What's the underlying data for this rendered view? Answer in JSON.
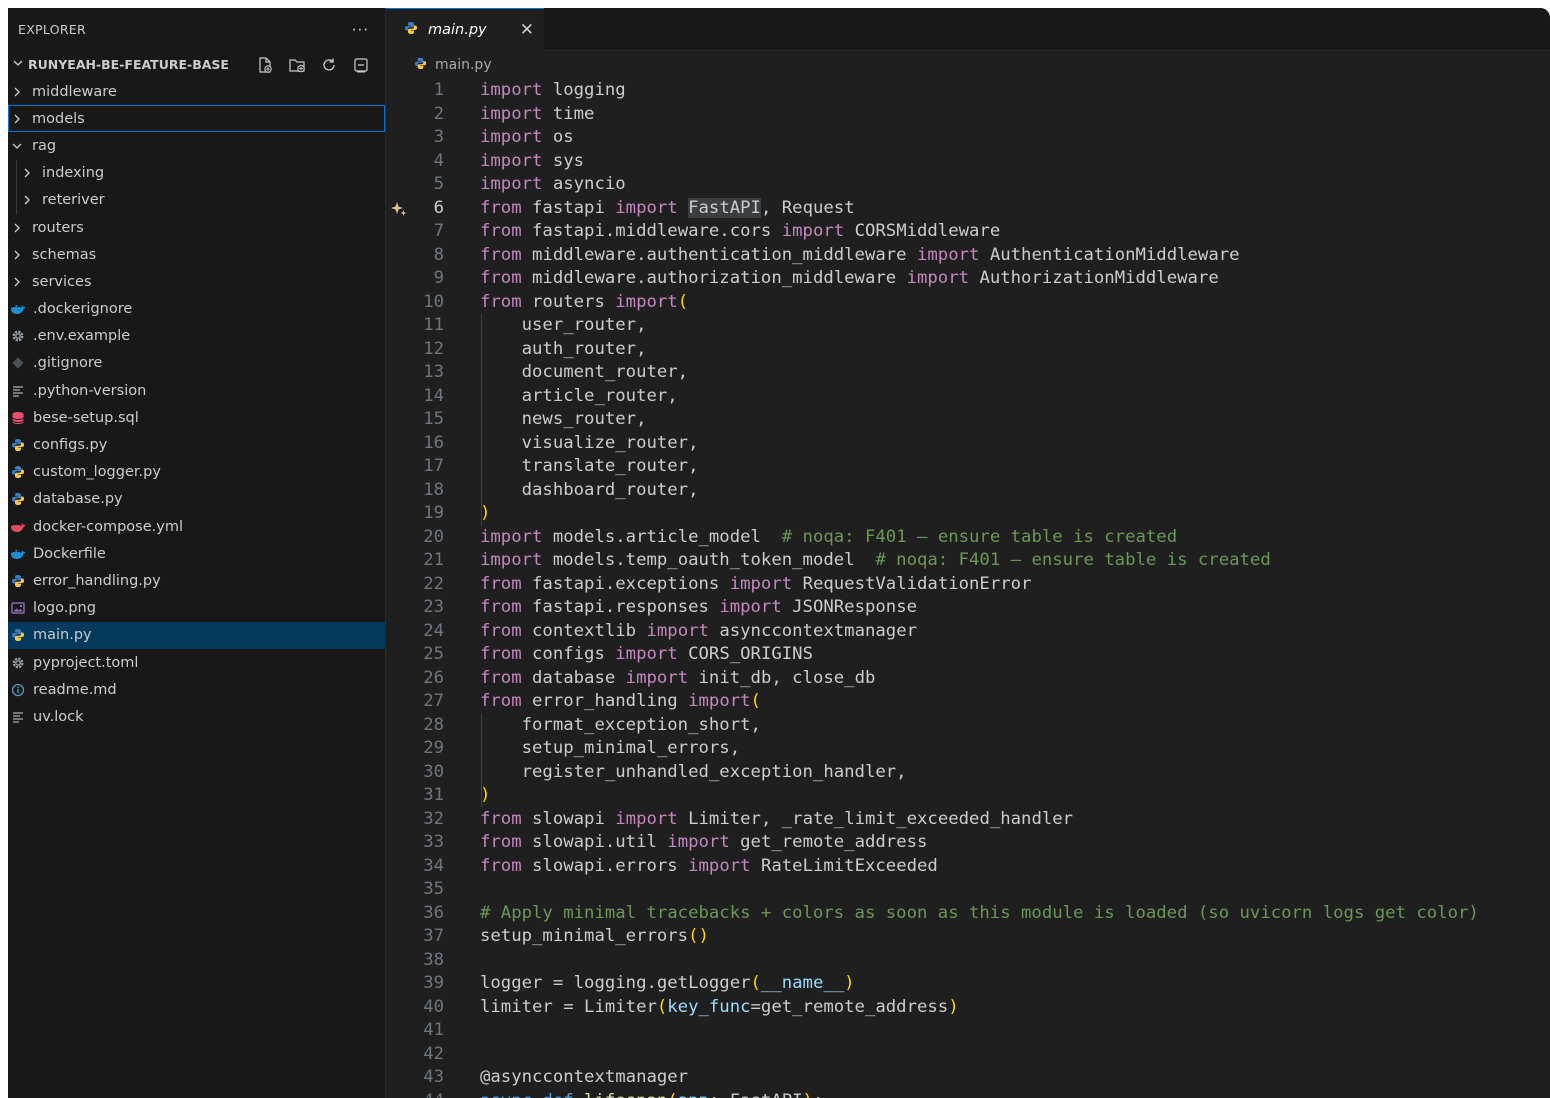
{
  "sidebar": {
    "title": "EXPLORER",
    "more": "···",
    "project": "RUNYEAH-BE-FEATURE-BASE",
    "items": [
      {
        "label": "middleware",
        "kind": "folder",
        "expanded": false,
        "depth": 0
      },
      {
        "label": "models",
        "kind": "folder",
        "expanded": false,
        "depth": 0,
        "focused": true
      },
      {
        "label": "rag",
        "kind": "folder",
        "expanded": true,
        "depth": 0
      },
      {
        "label": "indexing",
        "kind": "folder",
        "expanded": false,
        "depth": 1
      },
      {
        "label": "reteriver",
        "kind": "folder",
        "expanded": false,
        "depth": 1
      },
      {
        "label": "routers",
        "kind": "folder",
        "expanded": false,
        "depth": 0
      },
      {
        "label": "schemas",
        "kind": "folder",
        "expanded": false,
        "depth": 0
      },
      {
        "label": "services",
        "kind": "folder",
        "expanded": false,
        "depth": 0
      },
      {
        "label": ".dockerignore",
        "kind": "file",
        "icon": "docker-icon",
        "depth": 0
      },
      {
        "label": ".env.example",
        "kind": "file",
        "icon": "gear-icon",
        "depth": 0
      },
      {
        "label": ".gitignore",
        "kind": "file",
        "icon": "git-icon",
        "depth": 0
      },
      {
        "label": ".python-version",
        "kind": "file",
        "icon": "lines-icon",
        "depth": 0
      },
      {
        "label": "bese-setup.sql",
        "kind": "file",
        "icon": "database-icon",
        "depth": 0
      },
      {
        "label": "configs.py",
        "kind": "file",
        "icon": "python-icon",
        "depth": 0
      },
      {
        "label": "custom_logger.py",
        "kind": "file",
        "icon": "python-icon",
        "depth": 0
      },
      {
        "label": "database.py",
        "kind": "file",
        "icon": "python-icon",
        "depth": 0
      },
      {
        "label": "docker-compose.yml",
        "kind": "file",
        "icon": "docker-compose-icon",
        "depth": 0
      },
      {
        "label": "Dockerfile",
        "kind": "file",
        "icon": "docker-icon",
        "depth": 0
      },
      {
        "label": "error_handling.py",
        "kind": "file",
        "icon": "python-icon",
        "depth": 0
      },
      {
        "label": "logo.png",
        "kind": "file",
        "icon": "image-icon",
        "depth": 0
      },
      {
        "label": "main.py",
        "kind": "file",
        "icon": "python-icon",
        "depth": 0,
        "selected": true
      },
      {
        "label": "pyproject.toml",
        "kind": "file",
        "icon": "gear-icon",
        "depth": 0
      },
      {
        "label": "readme.md",
        "kind": "file",
        "icon": "info-icon",
        "depth": 0
      },
      {
        "label": "uv.lock",
        "kind": "file",
        "icon": "lines-icon",
        "depth": 0
      }
    ]
  },
  "editor": {
    "tab_label": "main.py",
    "close_glyph": "✕",
    "breadcrumb": "main.py",
    "active_line": 6,
    "lines": [
      [
        [
          "kw",
          "import"
        ],
        [
          "",
          "logging"
        ]
      ],
      [
        [
          "kw",
          "import"
        ],
        [
          "",
          "time"
        ]
      ],
      [
        [
          "kw",
          "import"
        ],
        [
          "",
          "os"
        ]
      ],
      [
        [
          "kw",
          "import"
        ],
        [
          "",
          "sys"
        ]
      ],
      [
        [
          "kw",
          "import"
        ],
        [
          "",
          "asyncio"
        ]
      ],
      [
        [
          "kw",
          "from"
        ],
        [
          "",
          "fastapi"
        ],
        [
          "kw",
          "import"
        ],
        [
          "hl",
          "FastAPI"
        ],
        [
          "",
          ","
        ],
        [
          "",
          "Request"
        ]
      ],
      [
        [
          "kw",
          "from"
        ],
        [
          "",
          "fastapi.middleware.cors"
        ],
        [
          "kw",
          "import"
        ],
        [
          "",
          "CORSMiddleware"
        ]
      ],
      [
        [
          "kw",
          "from"
        ],
        [
          "",
          "middleware.authentication_middleware"
        ],
        [
          "kw",
          "import"
        ],
        [
          "",
          "AuthenticationMiddleware"
        ]
      ],
      [
        [
          "kw",
          "from"
        ],
        [
          "",
          "middleware.authorization_middleware"
        ],
        [
          "kw",
          "import"
        ],
        [
          "",
          "AuthorizationMiddleware"
        ]
      ],
      [
        [
          "kw",
          "from"
        ],
        [
          "",
          "routers"
        ],
        [
          "kw",
          "import"
        ],
        [
          "par",
          "("
        ]
      ],
      [
        [
          "",
          "    user_router,"
        ]
      ],
      [
        [
          "",
          "    auth_router,"
        ]
      ],
      [
        [
          "",
          "    document_router,"
        ]
      ],
      [
        [
          "",
          "    article_router,"
        ]
      ],
      [
        [
          "",
          "    news_router,"
        ]
      ],
      [
        [
          "",
          "    visualize_router,"
        ]
      ],
      [
        [
          "",
          "    translate_router,"
        ]
      ],
      [
        [
          "",
          "    dashboard_router,"
        ]
      ],
      [
        [
          "par",
          ")"
        ]
      ],
      [
        [
          "kw",
          "import"
        ],
        [
          "",
          "models.article_model  "
        ],
        [
          "cm",
          "# noqa: F401 — ensure table is created"
        ]
      ],
      [
        [
          "kw",
          "import"
        ],
        [
          "",
          "models.temp_oauth_token_model  "
        ],
        [
          "cm",
          "# noqa: F401 — ensure table is created"
        ]
      ],
      [
        [
          "kw",
          "from"
        ],
        [
          "",
          "fastapi.exceptions"
        ],
        [
          "kw",
          "import"
        ],
        [
          "",
          "RequestValidationError"
        ]
      ],
      [
        [
          "kw",
          "from"
        ],
        [
          "",
          "fastapi.responses"
        ],
        [
          "kw",
          "import"
        ],
        [
          "",
          "JSONResponse"
        ]
      ],
      [
        [
          "kw",
          "from"
        ],
        [
          "",
          "contextlib"
        ],
        [
          "kw",
          "import"
        ],
        [
          "",
          "asynccontextmanager"
        ]
      ],
      [
        [
          "kw",
          "from"
        ],
        [
          "",
          "configs"
        ],
        [
          "kw",
          "import"
        ],
        [
          "",
          "CORS_ORIGINS"
        ]
      ],
      [
        [
          "kw",
          "from"
        ],
        [
          "",
          "database"
        ],
        [
          "kw",
          "import"
        ],
        [
          "",
          "init_db, close_db"
        ]
      ],
      [
        [
          "kw",
          "from"
        ],
        [
          "",
          "error_handling"
        ],
        [
          "kw",
          "import"
        ],
        [
          "par",
          "("
        ]
      ],
      [
        [
          "",
          "    format_exception_short,"
        ]
      ],
      [
        [
          "",
          "    setup_minimal_errors,"
        ]
      ],
      [
        [
          "",
          "    register_unhandled_exception_handler,"
        ]
      ],
      [
        [
          "par",
          ")"
        ]
      ],
      [
        [
          "kw",
          "from"
        ],
        [
          "",
          "slowapi"
        ],
        [
          "kw",
          "import"
        ],
        [
          "",
          "Limiter, _rate_limit_exceeded_handler"
        ]
      ],
      [
        [
          "kw",
          "from"
        ],
        [
          "",
          "slowapi.util"
        ],
        [
          "kw",
          "import"
        ],
        [
          "",
          "get_remote_address"
        ]
      ],
      [
        [
          "kw",
          "from"
        ],
        [
          "",
          "slowapi.errors"
        ],
        [
          "kw",
          "import"
        ],
        [
          "",
          "RateLimitExceeded"
        ]
      ],
      [],
      [
        [
          "cm",
          "# Apply minimal tracebacks + colors as soon as this module is loaded (so uvicorn logs get color)"
        ]
      ],
      [
        [
          "",
          "setup_minimal_errors"
        ],
        [
          "par",
          "()"
        ]
      ],
      [],
      [
        [
          "",
          "logger = logging.getLogger"
        ],
        [
          "par",
          "("
        ],
        [
          "var",
          "__name__"
        ],
        [
          "par",
          ")"
        ]
      ],
      [
        [
          "",
          "limiter = Limiter"
        ],
        [
          "par",
          "("
        ],
        [
          "var",
          "key_func"
        ],
        [
          "",
          "=get_remote_address"
        ],
        [
          "par",
          ")"
        ]
      ],
      [],
      [],
      [
        [
          "",
          "@asynccontextmanager"
        ]
      ],
      [
        [
          "kd",
          "async def"
        ],
        [
          "fn",
          " lifespan"
        ],
        [
          "par",
          "("
        ],
        [
          "var",
          "app"
        ],
        [
          "",
          ": FastAPI"
        ],
        [
          "par",
          ")"
        ],
        [
          "",
          ":"
        ]
      ]
    ]
  }
}
